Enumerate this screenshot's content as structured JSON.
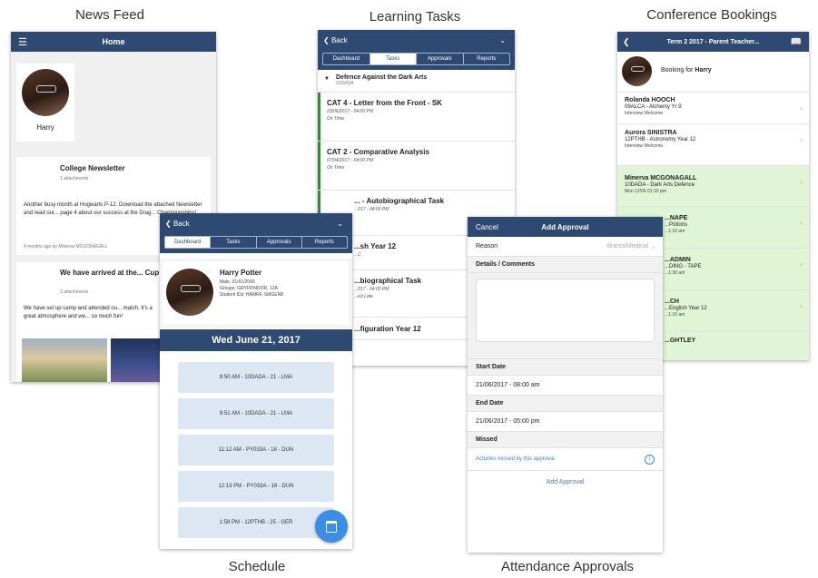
{
  "captions": {
    "news_feed": "News Feed",
    "learning_tasks": "Learning Tasks",
    "conference_bookings": "Conference Bookings",
    "schedule": "Schedule",
    "attendance_approvals": "Attendance Approvals"
  },
  "news_feed": {
    "title": "Home",
    "profile_name": "Harry",
    "posts": [
      {
        "title": "College Newsletter",
        "attachments": "1 attachments",
        "body": "Another busy month at Hogwarts P-12.  Download the attached Newsletter and read our... page 4 about our success at the Drag... Championships!",
        "meta": "4 months ago by Minerva MCGONAGALL"
      },
      {
        "title": "We have arrived at the... Cup!",
        "attachments": "2 attachments",
        "body": "We have set up camp and attended ou... match. It's a great atmosphere and we... so much fun!"
      }
    ]
  },
  "learning_tasks": {
    "back": "Back",
    "tabs": [
      "Dashboard",
      "Tasks",
      "Approvals",
      "Reports"
    ],
    "group": {
      "title": "Defence Against the Dark Arts",
      "code": "10DADA"
    },
    "items": [
      {
        "title": "CAT 4 - Letter from the Front - SK",
        "date": "23/06/2017 - 04:00 PM",
        "status": "On Time"
      },
      {
        "title": "CAT 2 - Comparative Analysis",
        "date": "07/04/2017 - 04:00 PM",
        "status": "On Time"
      },
      {
        "title": "... - Autobiographical Task",
        "date": "...017 - 04:00 PM",
        "status": ""
      },
      {
        "title": "...sh Year 12",
        "date": "...C",
        "status": ""
      },
      {
        "title": "...biographical Task",
        "date": "...017 - 04:00 PM",
        "status": "...ed Late"
      },
      {
        "title": "...figuration Year 12",
        "date": "",
        "status": ""
      }
    ]
  },
  "conference": {
    "title": "Term 2 2017 - Parent Teacher...",
    "booking_prefix": "Booking for",
    "booking_name": "Harry",
    "items": [
      {
        "name": "Rolanda HOOCH",
        "class": "09ALCA - Alchemy Yr 9",
        "meta": "Interview Welcome",
        "green": false
      },
      {
        "name": "Aurora SINISTRA",
        "class": "12PTHB - Astronomy Year 12",
        "meta": "Interview Welcome",
        "green": false
      },
      {
        "name": "Minerva MCGONAGALL",
        "class": "10DADA - Dark Arts Defence",
        "meta": "Mon 12/06 01:10 pm",
        "green": true
      },
      {
        "name": "...NAPE",
        "class": "...Potions",
        "meta": "...1:10 am",
        "green": true
      },
      {
        "name": "...ADMIN",
        "class": "...DING - TAPE",
        "meta": "...1:30 am",
        "green": true
      },
      {
        "name": "...CH",
        "class": "...English Year 12",
        "meta": "...1:10 am",
        "green": true
      },
      {
        "name": "...GHTLEY",
        "class": "",
        "meta": "",
        "green": true
      }
    ]
  },
  "schedule": {
    "back": "Back",
    "tabs": [
      "Dashboard",
      "Tasks",
      "Approvals",
      "Reports"
    ],
    "student": {
      "name": "Harry Potter",
      "l1": "Male, 01/01/2000",
      "l2": "Groups: GRYFFINDOR, 12A",
      "l3": "Student IDs: HAMRF, SMGEN8"
    },
    "date": "Wed June 21, 2017",
    "slots": [
      "8:50 AM - 10DADA - 21 - LMA",
      "9:51 AM - 10DADA - 21 - LMA",
      "11:12 AM - PY033A - 18 - DUN",
      "12:13 PM - PY033A - 18 - DUN",
      "1:58 PM - 12PTHB - 25 - GER"
    ]
  },
  "approval": {
    "cancel": "Cancel",
    "title": "Add Approval",
    "reason_label": "Reason",
    "reason_value": "Illness/Medical",
    "details_label": "Details / Comments",
    "start_label": "Start Date",
    "start_value": "21/06/2017 - 08:00 am",
    "end_label": "End Date",
    "end_value": "21/06/2017 - 05:00 pm",
    "missed_label": "Missed",
    "missed_link": "Activites missed by this approval",
    "add_button": "Add Approval"
  },
  "colors": {
    "nav": "#2e4a73",
    "accent": "#3b82e0",
    "green_row": "#dff5d5",
    "slot": "#dde7f4"
  }
}
